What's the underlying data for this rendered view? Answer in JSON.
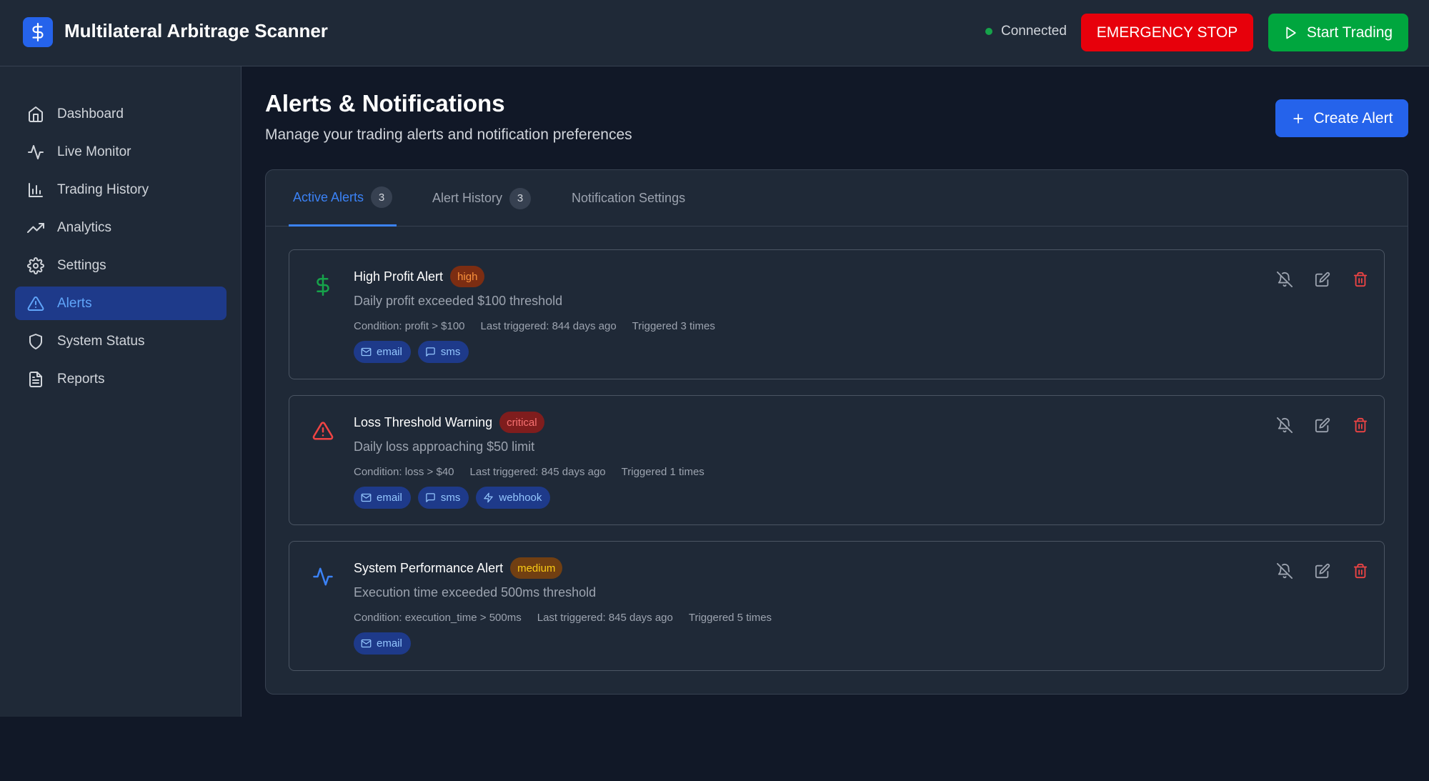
{
  "app": {
    "title": "Multilateral Arbitrage Scanner",
    "logo_icon": "dollar-icon"
  },
  "header": {
    "connection_status": "Connected",
    "emergency_label": "EMERGENCY STOP",
    "start_label": "Start Trading"
  },
  "sidebar": {
    "items": [
      {
        "label": "Dashboard",
        "icon": "home-icon"
      },
      {
        "label": "Live Monitor",
        "icon": "activity-icon"
      },
      {
        "label": "Trading History",
        "icon": "bar-chart-icon"
      },
      {
        "label": "Analytics",
        "icon": "trending-up-icon"
      },
      {
        "label": "Settings",
        "icon": "gear-icon"
      },
      {
        "label": "Alerts",
        "icon": "alert-triangle-icon",
        "active": true
      },
      {
        "label": "System Status",
        "icon": "shield-icon"
      },
      {
        "label": "Reports",
        "icon": "file-text-icon"
      }
    ]
  },
  "main": {
    "title": "Alerts & Notifications",
    "subtitle": "Manage your trading alerts and notification preferences",
    "create_label": "Create Alert",
    "tabs": [
      {
        "label": "Active Alerts",
        "count": "3",
        "active": true
      },
      {
        "label": "Alert History",
        "count": "3"
      },
      {
        "label": "Notification Settings"
      }
    ],
    "alerts": [
      {
        "icon": "dollar-icon",
        "title": "High Profit Alert",
        "severity": "high",
        "description": "Daily profit exceeded $100 threshold",
        "condition": "Condition: profit > $100",
        "last_triggered": "Last triggered: 844 days ago",
        "count": "Triggered 3 times",
        "channels": [
          "email",
          "sms"
        ]
      },
      {
        "icon": "alert-triangle-icon",
        "title": "Loss Threshold Warning",
        "severity": "critical",
        "description": "Daily loss approaching $50 limit",
        "condition": "Condition: loss > $40",
        "last_triggered": "Last triggered: 845 days ago",
        "count": "Triggered 1 times",
        "channels": [
          "email",
          "sms",
          "webhook"
        ]
      },
      {
        "icon": "activity-icon",
        "title": "System Performance Alert",
        "severity": "medium",
        "description": "Execution time exceeded 500ms threshold",
        "condition": "Condition: execution_time > 500ms",
        "last_triggered": "Last triggered: 845 days ago",
        "count": "Triggered 5 times",
        "channels": [
          "email"
        ]
      }
    ]
  },
  "colors": {
    "accent": "#2563eb",
    "danger": "#e7000b",
    "success": "#00a63e",
    "background": "#111827",
    "surface": "#1f2937"
  }
}
